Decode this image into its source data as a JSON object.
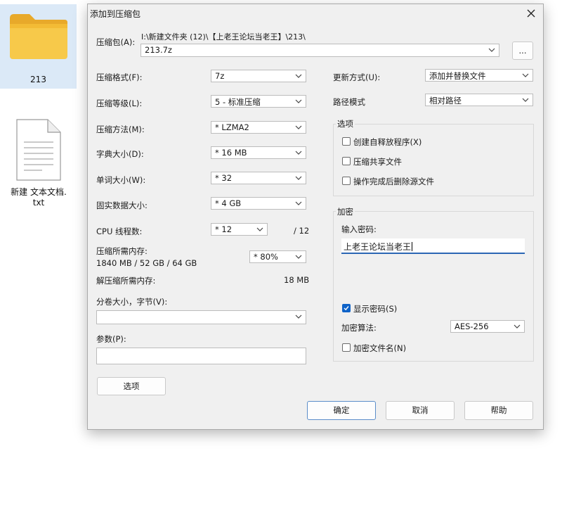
{
  "desktop": {
    "folder_label": "213",
    "file_label_line1": "新建 文本文档.",
    "file_label_line2": "txt"
  },
  "dialog": {
    "title": "添加到压缩包",
    "archive": {
      "label": "压缩包(A):",
      "path": "I:\\新建文件夹 (12)\\【上老王论坛当老王】\\213\\",
      "name": "213.7z",
      "browse_label": "..."
    },
    "left": {
      "format_label": "压缩格式(F):",
      "format_value": "7z",
      "level_label": "压缩等级(L):",
      "level_value": "5 - 标准压缩",
      "method_label": "压缩方法(M):",
      "method_value": "* LZMA2",
      "dict_label": "字典大小(D):",
      "dict_value": "* 16 MB",
      "word_label": "单词大小(W):",
      "word_value": "* 32",
      "solid_label": "固实数据大小:",
      "solid_value": "* 4 GB",
      "cpu_label": "CPU 线程数:",
      "cpu_value": "* 12",
      "cpu_total": "/ 12",
      "mem_label": "压缩所需内存:",
      "mem_detail": "1840 MB / 52 GB / 64 GB",
      "mem_value": "* 80%",
      "decomp_label": "解压缩所需内存:",
      "decomp_value": "18 MB",
      "split_label": "分卷大小，字节(V):",
      "split_value": "",
      "params_label": "参数(P):",
      "params_value": "",
      "options_button": "选项"
    },
    "right": {
      "update_label": "更新方式(U):",
      "update_value": "添加并替换文件",
      "path_label": "路径模式",
      "path_value": "相对路径",
      "options_group": "选项",
      "opt_sfx": "创建自释放程序(X)",
      "opt_shared": "压缩共享文件",
      "opt_delete": "操作完成后删除源文件",
      "encrypt_group": "加密",
      "password_label": "输入密码:",
      "password_value": "上老王论坛当老王",
      "show_password": "显示密码(S)",
      "show_password_checked": true,
      "algo_label": "加密算法:",
      "algo_value": "AES-256",
      "encrypt_names": "加密文件名(N)"
    },
    "buttons": {
      "ok": "确定",
      "cancel": "取消",
      "help": "帮助"
    },
    "colors": {
      "accent": "#0f63c8",
      "dialog_bg": "#f0f0f0"
    }
  }
}
